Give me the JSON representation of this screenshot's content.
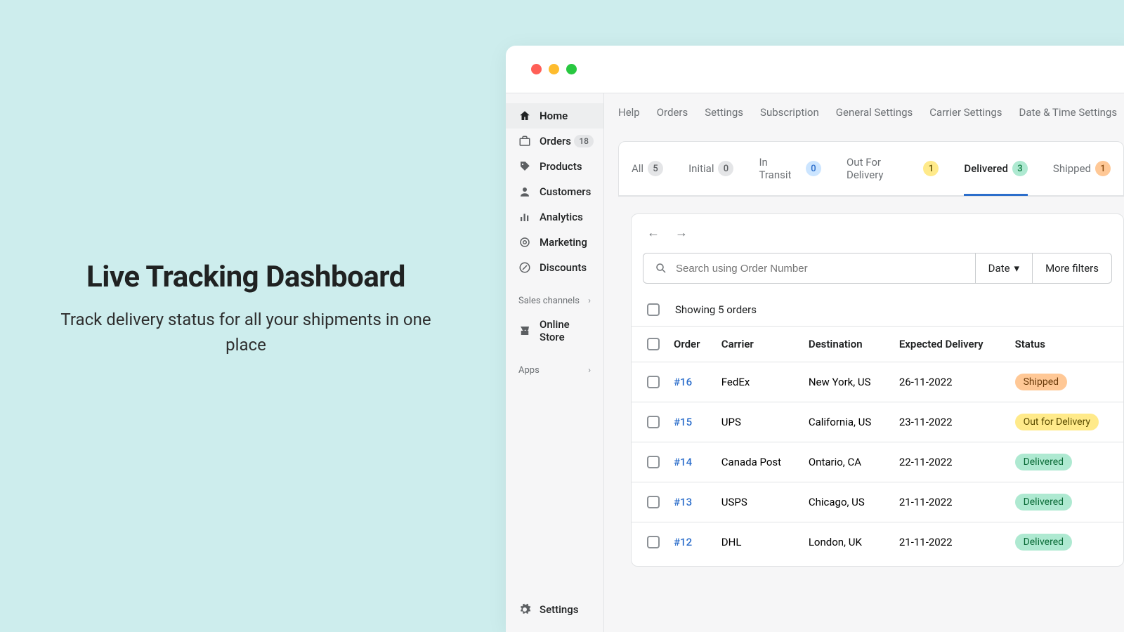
{
  "hero": {
    "title": "Live Tracking Dashboard",
    "subtitle": "Track delivery status for all your shipments in one place"
  },
  "sidebar": {
    "home": "Home",
    "orders": "Orders",
    "orders_count": "18",
    "products": "Products",
    "customers": "Customers",
    "analytics": "Analytics",
    "marketing": "Marketing",
    "discounts": "Discounts",
    "sales_channels": "Sales channels",
    "online_store": "Online Store",
    "apps": "Apps",
    "settings": "Settings"
  },
  "topnav": {
    "help": "Help",
    "orders": "Orders",
    "settings": "Settings",
    "subscription": "Subscription",
    "general": "General Settings",
    "carrier": "Carrier Settings",
    "datetime": "Date & Time Settings"
  },
  "tabs": {
    "all": "All",
    "all_count": "5",
    "initial": "Initial",
    "initial_count": "0",
    "transit": "In Transit",
    "transit_count": "0",
    "out": "Out For Delivery",
    "out_count": "1",
    "delivered": "Delivered",
    "delivered_count": "3",
    "shipped": "Shipped",
    "shipped_count": "1"
  },
  "search": {
    "placeholder": "Search using Order Number",
    "date": "Date",
    "more_filters": "More filters"
  },
  "showing": "Showing 5 orders",
  "columns": {
    "order": "Order",
    "carrier": "Carrier",
    "destination": "Destination",
    "expected": "Expected Delivery",
    "status": "Status"
  },
  "rows": [
    {
      "order": "#16",
      "carrier": "FedEx",
      "dest": "New York, US",
      "date": "26-11-2022",
      "status": "Shipped",
      "cls": "st-shipped"
    },
    {
      "order": "#15",
      "carrier": "UPS",
      "dest": "California, US",
      "date": "23-11-2022",
      "status": "Out for Delivery",
      "cls": "st-out"
    },
    {
      "order": "#14",
      "carrier": "Canada Post",
      "dest": "Ontario, CA",
      "date": "22-11-2022",
      "status": "Delivered",
      "cls": "st-delivered"
    },
    {
      "order": "#13",
      "carrier": "USPS",
      "dest": "Chicago, US",
      "date": "21-11-2022",
      "status": "Delivered",
      "cls": "st-delivered"
    },
    {
      "order": "#12",
      "carrier": "DHL",
      "dest": "London, UK",
      "date": "21-11-2022",
      "status": "Delivered",
      "cls": "st-delivered"
    }
  ]
}
